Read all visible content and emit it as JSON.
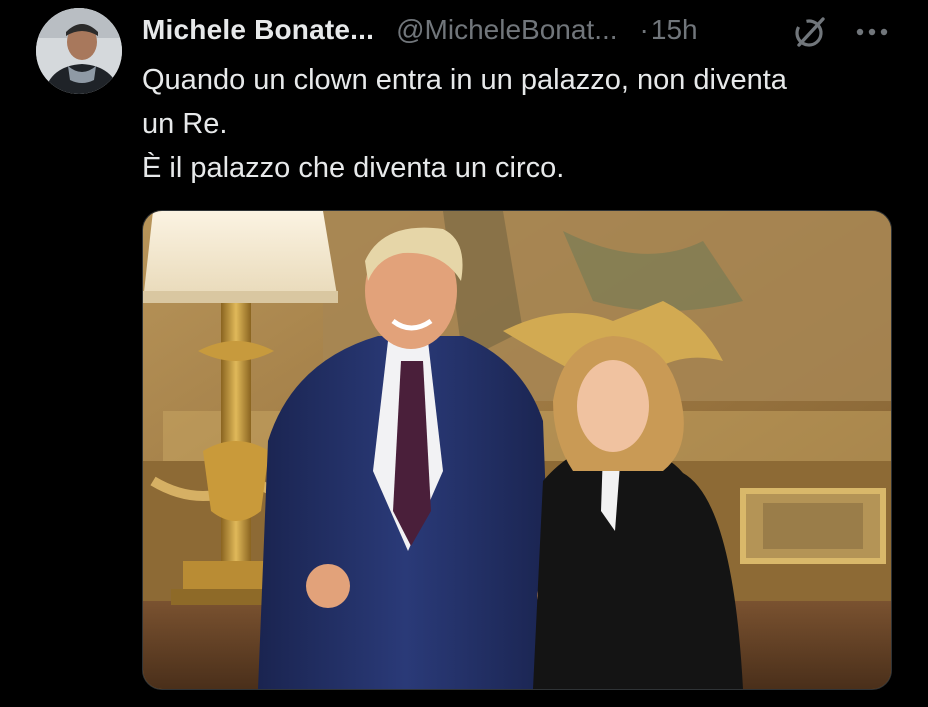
{
  "author": {
    "display_name": "Michele Bonate...",
    "handle": "@MicheleBonat...",
    "separator": "·",
    "time": "15h"
  },
  "icons": {
    "avatar": "avatar",
    "grok": "grok-icon",
    "more": "more-options-icon"
  },
  "tweet": {
    "lines": [
      "Quando un clown entra in un palazzo, non diventa",
      "un Re.",
      "È il palazzo che diventa un circo."
    ]
  },
  "colors": {
    "background": "#000000",
    "primary_text": "#e7e9ea",
    "secondary_text": "#71767b",
    "media_border": "#2f3336"
  }
}
